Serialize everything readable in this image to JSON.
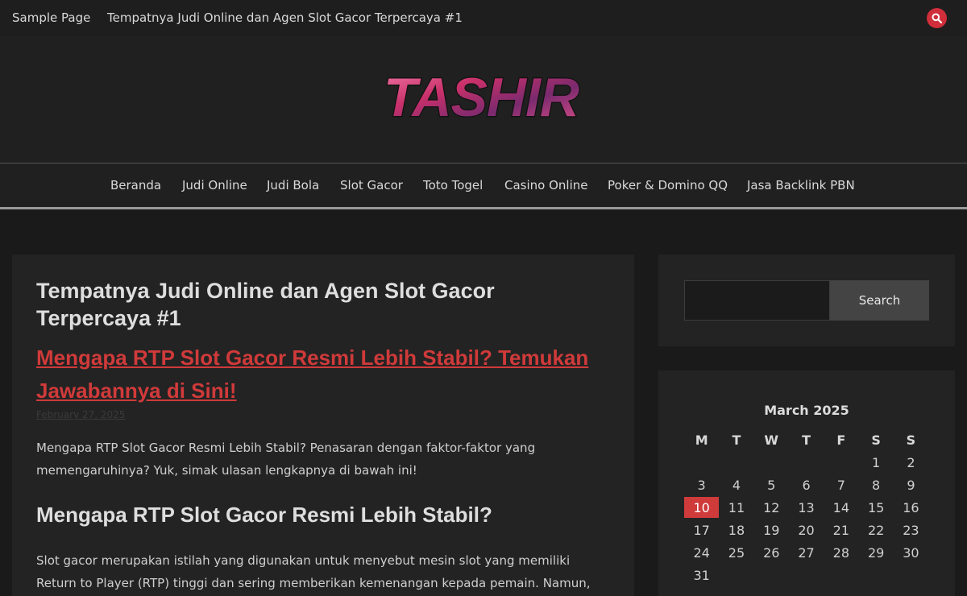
{
  "topbar": {
    "links": [
      "Sample Page",
      "Tempatnya Judi Online dan Agen Slot Gacor Terpercaya #1"
    ],
    "search_icon": "search-icon",
    "accent": "#cf2e3a"
  },
  "header": {
    "logo_text": "TASHIR"
  },
  "nav": {
    "items": [
      "Beranda",
      "Judi Online",
      "Judi Bola",
      "Slot Gacor",
      "Toto Togel",
      "Casino Online",
      "Poker & Domino QQ",
      "Jasa Backlink PBN"
    ]
  },
  "main": {
    "page_title": "Tempatnya Judi Online dan Agen Slot Gacor Terpercaya #1",
    "post": {
      "title": "Mengapa RTP Slot Gacor Resmi Lebih Stabil? Temukan Jawabannya di Sini!",
      "date": "February 27, 2025",
      "intro": "Mengapa RTP Slot Gacor Resmi Lebih Stabil? Penasaran dengan faktor-faktor yang memengaruhinya? Yuk, simak ulasan lengkapnya di bawah ini!",
      "heading": "Mengapa RTP Slot Gacor Resmi Lebih Stabil?",
      "body": "Slot gacor merupakan istilah yang digunakan untuk menyebut mesin slot yang memiliki Return to Player (RTP) tinggi dan sering memberikan kemenangan kepada pemain. Namun, ada"
    },
    "title_color": "#d03a3a"
  },
  "sidebar": {
    "search": {
      "value": "",
      "button_label": "Search"
    },
    "calendar": {
      "caption": "March 2025",
      "weekdays": [
        "M",
        "T",
        "W",
        "T",
        "F",
        "S",
        "S"
      ],
      "weeks": [
        [
          "",
          "",
          "",
          "",
          "",
          "1",
          "2"
        ],
        [
          "3",
          "4",
          "5",
          "6",
          "7",
          "8",
          "9"
        ],
        [
          "10",
          "11",
          "12",
          "13",
          "14",
          "15",
          "16"
        ],
        [
          "17",
          "18",
          "19",
          "20",
          "21",
          "22",
          "23"
        ],
        [
          "24",
          "25",
          "26",
          "27",
          "28",
          "29",
          "30"
        ],
        [
          "31",
          "",
          "",
          "",
          "",
          "",
          ""
        ]
      ],
      "today": "10",
      "today_color": "#cf3a3a"
    }
  }
}
